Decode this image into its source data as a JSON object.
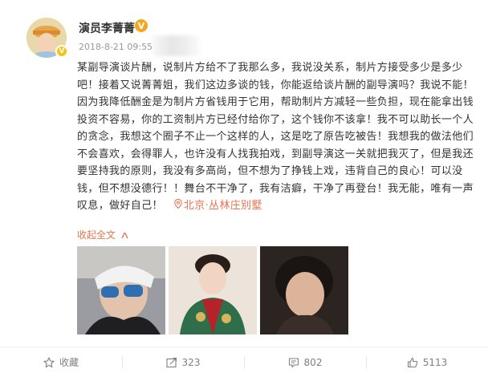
{
  "author": {
    "name": "演员李菁菁",
    "verified_badge": "V",
    "timestamp": "2018-8-21 09:55"
  },
  "post": {
    "text": "某副导演谈片酬，说制片方给不了我那么多，我说没关系，制片方接受多少是多少吧！接着又说菁菁姐，我们这边多谈的钱，你能返给谈片酬的副导演吗？我说不能！因为我降低酬金是为制片方省钱用于它用，帮助制片方减轻一些负担，现在能拿出钱投资不容易，你的工资制片方已经付给你了，这个钱你不该拿！我不可以助长一个人的贪念，我想这个圈子不止一个这样的人，这是吃了原告吃被告！我想我的做法他们不会喜欢，会得罪人，也许没有人找我拍戏，到副导演这一关就把我灭了，但是我还要坚持我的原则，我没有多高尚，但不想为了挣钱上戏，违背自己的良心！可以没钱，但不想没德行！！舞台不干净了，我有洁癖，干净了再登台！我无能，唯有一声叹息，做好自己！",
    "location": "北京·丛林庄别墅",
    "collapse_label": "收起全文"
  },
  "actions": {
    "favorite_label": "收藏",
    "repost_count": "323",
    "comment_count": "802",
    "like_count": "5113"
  },
  "colors": {
    "link": "#eb7350",
    "verified": "#f7a51c",
    "muted": "#808080"
  }
}
